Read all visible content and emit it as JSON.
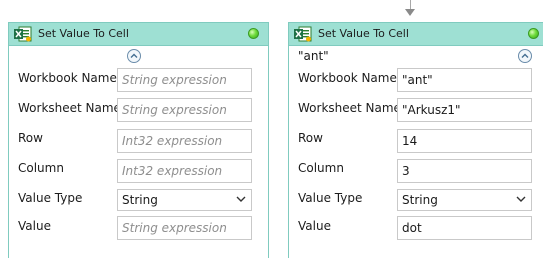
{
  "colors": {
    "card_border": "#80cbbf",
    "header_bg": "#9ee0d3",
    "status_green": "#6fdb3c",
    "placeholder_text": "#8e8e8e"
  },
  "activities": [
    {
      "title": "Set Value To Cell",
      "display_name": "",
      "fields": {
        "workbook_name": {
          "label": "Workbook Name",
          "value": "",
          "placeholder": "String expression"
        },
        "worksheet_name": {
          "label": "Worksheet Name",
          "value": "",
          "placeholder": "String expression"
        },
        "row": {
          "label": "Row",
          "value": "",
          "placeholder": "Int32 expression"
        },
        "column": {
          "label": "Column",
          "value": "",
          "placeholder": "Int32 expression"
        },
        "value_type": {
          "label": "Value Type",
          "selected": "String"
        },
        "value": {
          "label": "Value",
          "value": "",
          "placeholder": "String expression"
        }
      }
    },
    {
      "title": "Set Value To Cell",
      "display_name": "\"ant\"",
      "fields": {
        "workbook_name": {
          "label": "Workbook Name",
          "value": "\"ant\"",
          "placeholder": ""
        },
        "worksheet_name": {
          "label": "Worksheet Name",
          "value": "\"Arkusz1\"",
          "placeholder": ""
        },
        "row": {
          "label": "Row",
          "value": "14",
          "placeholder": ""
        },
        "column": {
          "label": "Column",
          "value": "3",
          "placeholder": ""
        },
        "value_type": {
          "label": "Value Type",
          "selected": "String"
        },
        "value": {
          "label": "Value",
          "value": "dot",
          "placeholder": ""
        }
      }
    }
  ],
  "icons": {
    "activity_icon": "excel-icon",
    "status": "status-indicator-icon",
    "collapse": "chevron-up-icon",
    "dropdown": "chevron-down-icon",
    "flow_arrow": "arrow-down-icon"
  }
}
